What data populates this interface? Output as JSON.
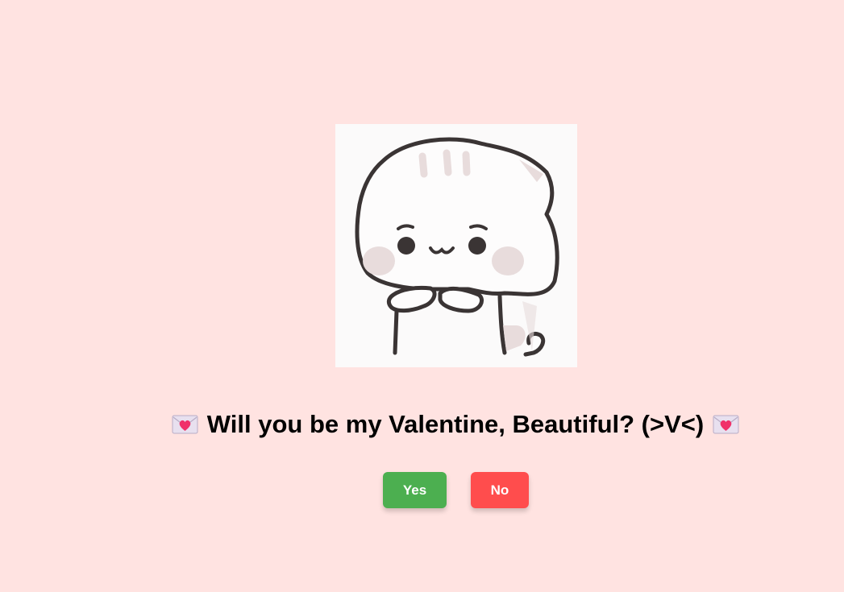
{
  "page": {
    "background": "#ffe3e1"
  },
  "image": {
    "icon": "cute-white-cat-sticker"
  },
  "question": {
    "text": "Will you be my Valentine, Beautiful? (>V<)",
    "prefix_icon": "love-letter-icon",
    "suffix_icon": "love-letter-icon"
  },
  "buttons": {
    "yes": {
      "label": "Yes",
      "color": "#4caf50"
    },
    "no": {
      "label": "No",
      "color": "#ff4d4d"
    }
  }
}
